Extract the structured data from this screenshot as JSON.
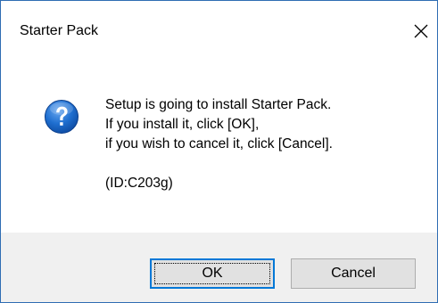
{
  "window": {
    "title": "Starter Pack",
    "close_icon": "close-icon"
  },
  "message": {
    "icon": "question-icon",
    "lines": [
      "Setup is going to install Starter Pack.",
      "If you install it, click [OK],",
      "if you wish to cancel it, click [Cancel]."
    ],
    "id_text": "(ID:C203g)"
  },
  "buttons": {
    "ok_label": "OK",
    "cancel_label": "Cancel"
  },
  "colors": {
    "icon_blue": "#1f6fd0",
    "focus_blue": "#0078d7",
    "footer_bg": "#f0f0f0",
    "button_bg": "#e1e1e1"
  }
}
